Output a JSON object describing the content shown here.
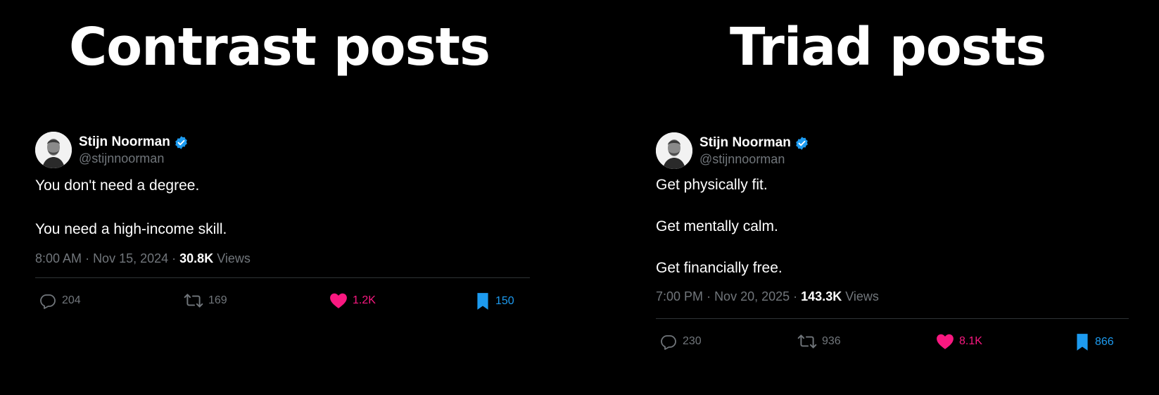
{
  "headings": {
    "left": "Contrast posts",
    "right": "Triad posts"
  },
  "colors": {
    "background": "#000000",
    "like": "#f91880",
    "bookmark": "#1d9bf0",
    "verified": "#1d9bf0",
    "muted": "#71767b"
  },
  "posts": [
    {
      "author": {
        "name": "Stijn Noorman",
        "handle": "@stijnnoorman",
        "avatar_icon": "profile-photo",
        "verified_icon": "verified-badge-icon"
      },
      "lines": [
        "You don't need a degree.",
        "You need a high-income skill."
      ],
      "meta": {
        "time": "8:00 AM",
        "date": "Nov 15, 2024",
        "views": "30.8K",
        "views_label": "Views"
      },
      "stats": {
        "replies": "204",
        "reposts": "169",
        "likes": "1.2K",
        "bookmarks": "150"
      }
    },
    {
      "author": {
        "name": "Stijn Noorman",
        "handle": "@stijnnoorman",
        "avatar_icon": "profile-photo",
        "verified_icon": "verified-badge-icon"
      },
      "lines": [
        "Get physically fit.",
        "Get mentally calm.",
        "Get financially free."
      ],
      "meta": {
        "time": "7:00 PM",
        "date": "Nov 20, 2025",
        "views": "143.3K",
        "views_label": "Views"
      },
      "stats": {
        "replies": "230",
        "reposts": "936",
        "likes": "8.1K",
        "bookmarks": "866"
      }
    }
  ]
}
